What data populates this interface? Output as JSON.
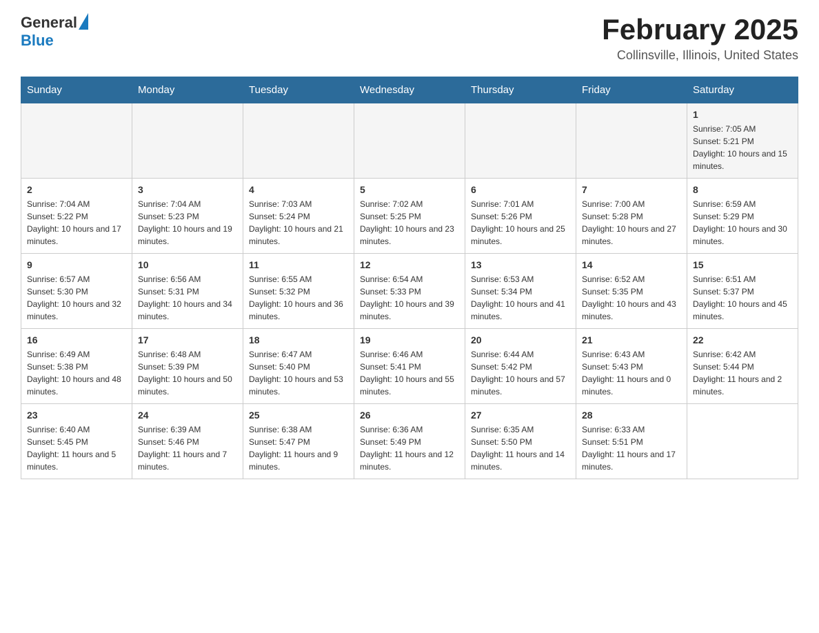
{
  "header": {
    "logo": {
      "general": "General",
      "blue": "Blue"
    },
    "title": "February 2025",
    "location": "Collinsville, Illinois, United States"
  },
  "weekdays": [
    "Sunday",
    "Monday",
    "Tuesday",
    "Wednesday",
    "Thursday",
    "Friday",
    "Saturday"
  ],
  "weeks": [
    [
      {
        "day": "",
        "info": ""
      },
      {
        "day": "",
        "info": ""
      },
      {
        "day": "",
        "info": ""
      },
      {
        "day": "",
        "info": ""
      },
      {
        "day": "",
        "info": ""
      },
      {
        "day": "",
        "info": ""
      },
      {
        "day": "1",
        "info": "Sunrise: 7:05 AM\nSunset: 5:21 PM\nDaylight: 10 hours and 15 minutes."
      }
    ],
    [
      {
        "day": "2",
        "info": "Sunrise: 7:04 AM\nSunset: 5:22 PM\nDaylight: 10 hours and 17 minutes."
      },
      {
        "day": "3",
        "info": "Sunrise: 7:04 AM\nSunset: 5:23 PM\nDaylight: 10 hours and 19 minutes."
      },
      {
        "day": "4",
        "info": "Sunrise: 7:03 AM\nSunset: 5:24 PM\nDaylight: 10 hours and 21 minutes."
      },
      {
        "day": "5",
        "info": "Sunrise: 7:02 AM\nSunset: 5:25 PM\nDaylight: 10 hours and 23 minutes."
      },
      {
        "day": "6",
        "info": "Sunrise: 7:01 AM\nSunset: 5:26 PM\nDaylight: 10 hours and 25 minutes."
      },
      {
        "day": "7",
        "info": "Sunrise: 7:00 AM\nSunset: 5:28 PM\nDaylight: 10 hours and 27 minutes."
      },
      {
        "day": "8",
        "info": "Sunrise: 6:59 AM\nSunset: 5:29 PM\nDaylight: 10 hours and 30 minutes."
      }
    ],
    [
      {
        "day": "9",
        "info": "Sunrise: 6:57 AM\nSunset: 5:30 PM\nDaylight: 10 hours and 32 minutes."
      },
      {
        "day": "10",
        "info": "Sunrise: 6:56 AM\nSunset: 5:31 PM\nDaylight: 10 hours and 34 minutes."
      },
      {
        "day": "11",
        "info": "Sunrise: 6:55 AM\nSunset: 5:32 PM\nDaylight: 10 hours and 36 minutes."
      },
      {
        "day": "12",
        "info": "Sunrise: 6:54 AM\nSunset: 5:33 PM\nDaylight: 10 hours and 39 minutes."
      },
      {
        "day": "13",
        "info": "Sunrise: 6:53 AM\nSunset: 5:34 PM\nDaylight: 10 hours and 41 minutes."
      },
      {
        "day": "14",
        "info": "Sunrise: 6:52 AM\nSunset: 5:35 PM\nDaylight: 10 hours and 43 minutes."
      },
      {
        "day": "15",
        "info": "Sunrise: 6:51 AM\nSunset: 5:37 PM\nDaylight: 10 hours and 45 minutes."
      }
    ],
    [
      {
        "day": "16",
        "info": "Sunrise: 6:49 AM\nSunset: 5:38 PM\nDaylight: 10 hours and 48 minutes."
      },
      {
        "day": "17",
        "info": "Sunrise: 6:48 AM\nSunset: 5:39 PM\nDaylight: 10 hours and 50 minutes."
      },
      {
        "day": "18",
        "info": "Sunrise: 6:47 AM\nSunset: 5:40 PM\nDaylight: 10 hours and 53 minutes."
      },
      {
        "day": "19",
        "info": "Sunrise: 6:46 AM\nSunset: 5:41 PM\nDaylight: 10 hours and 55 minutes."
      },
      {
        "day": "20",
        "info": "Sunrise: 6:44 AM\nSunset: 5:42 PM\nDaylight: 10 hours and 57 minutes."
      },
      {
        "day": "21",
        "info": "Sunrise: 6:43 AM\nSunset: 5:43 PM\nDaylight: 11 hours and 0 minutes."
      },
      {
        "day": "22",
        "info": "Sunrise: 6:42 AM\nSunset: 5:44 PM\nDaylight: 11 hours and 2 minutes."
      }
    ],
    [
      {
        "day": "23",
        "info": "Sunrise: 6:40 AM\nSunset: 5:45 PM\nDaylight: 11 hours and 5 minutes."
      },
      {
        "day": "24",
        "info": "Sunrise: 6:39 AM\nSunset: 5:46 PM\nDaylight: 11 hours and 7 minutes."
      },
      {
        "day": "25",
        "info": "Sunrise: 6:38 AM\nSunset: 5:47 PM\nDaylight: 11 hours and 9 minutes."
      },
      {
        "day": "26",
        "info": "Sunrise: 6:36 AM\nSunset: 5:49 PM\nDaylight: 11 hours and 12 minutes."
      },
      {
        "day": "27",
        "info": "Sunrise: 6:35 AM\nSunset: 5:50 PM\nDaylight: 11 hours and 14 minutes."
      },
      {
        "day": "28",
        "info": "Sunrise: 6:33 AM\nSunset: 5:51 PM\nDaylight: 11 hours and 17 minutes."
      },
      {
        "day": "",
        "info": ""
      }
    ]
  ]
}
